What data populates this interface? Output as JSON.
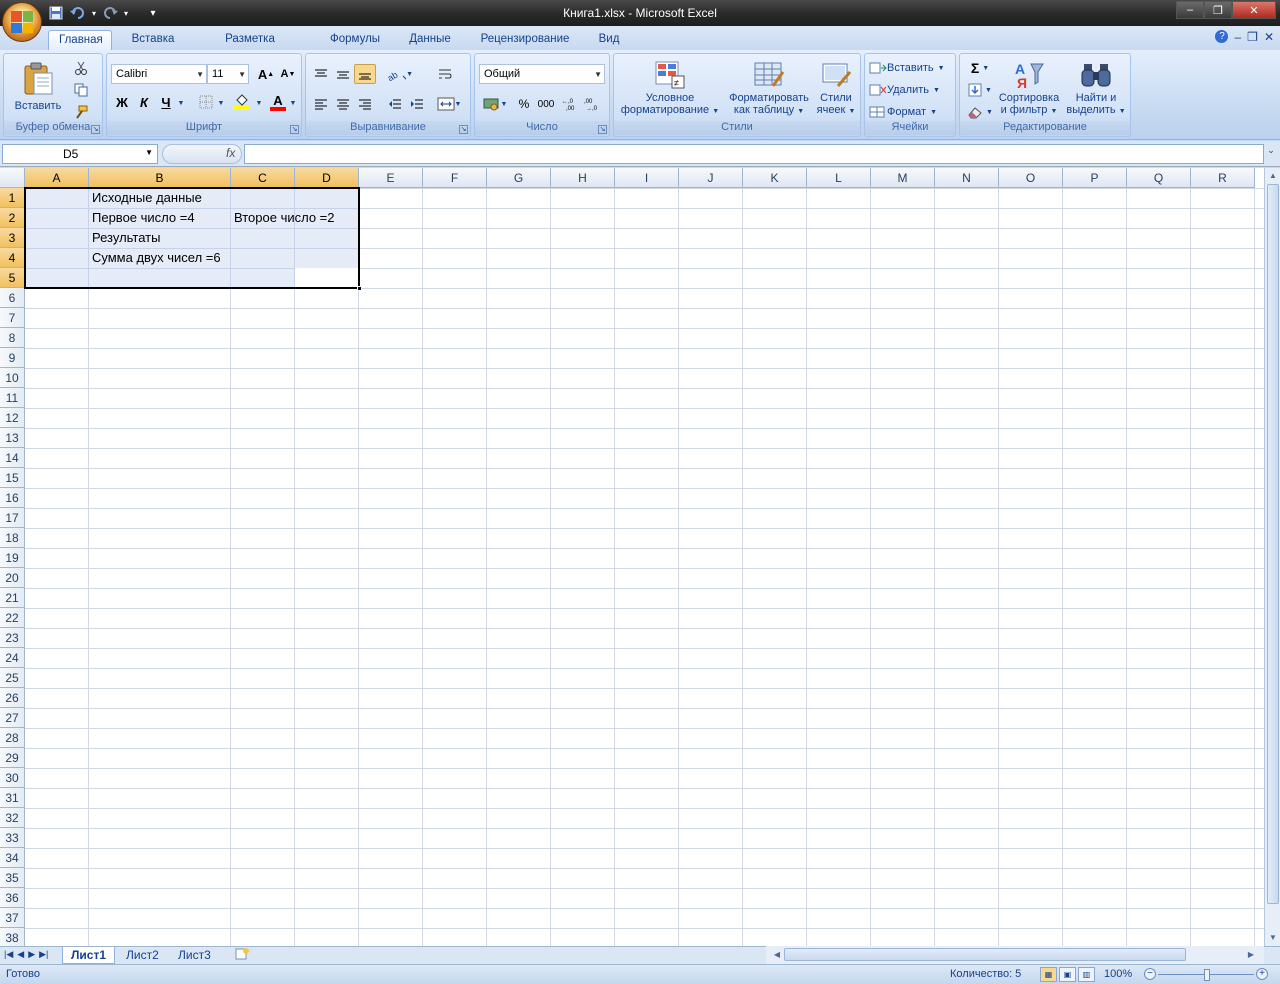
{
  "window": {
    "title": "Книга1.xlsx - Microsoft Excel",
    "minimize": "–",
    "restore": "❐",
    "close": "✕"
  },
  "qat": {
    "save_icon": "save-icon",
    "undo_icon": "undo-icon",
    "redo_icon": "redo-icon",
    "customize": "▾"
  },
  "tabs": [
    {
      "label": "Главная",
      "active": true
    },
    {
      "label": "Вставка"
    },
    {
      "label": "Разметка страницы"
    },
    {
      "label": "Формулы"
    },
    {
      "label": "Данные"
    },
    {
      "label": "Рецензирование"
    },
    {
      "label": "Вид"
    }
  ],
  "ribbon": {
    "clipboard": {
      "label": "Буфер обмена",
      "paste": "Вставить"
    },
    "font": {
      "label": "Шрифт",
      "name": "Calibri",
      "size": "11",
      "bold": "Ж",
      "italic": "К",
      "underline": "Ч",
      "grow": "A",
      "shrink": "A",
      "fill_color": "#ffff00",
      "font_color": "#ff0000",
      "color_letter": "A"
    },
    "alignment": {
      "label": "Выравнивание"
    },
    "number": {
      "label": "Число",
      "format": "Общий",
      "percent": "%",
      "thousands": "000"
    },
    "styles": {
      "label": "Стили",
      "cond_format_1": "Условное",
      "cond_format_2": "форматирование",
      "format_table_1": "Форматировать",
      "format_table_2": "как таблицу",
      "cell_styles_1": "Стили",
      "cell_styles_2": "ячеек"
    },
    "cells": {
      "label": "Ячейки",
      "insert": "Вставить",
      "delete": "Удалить",
      "format": "Формат"
    },
    "editing": {
      "label": "Редактирование",
      "sum": "Σ",
      "sort_1": "Сортировка",
      "sort_2": "и фильтр",
      "find_1": "Найти и",
      "find_2": "выделить"
    }
  },
  "formula_bar": {
    "name_box": "D5",
    "fx": "fx",
    "formula": ""
  },
  "columns": [
    "A",
    "B",
    "C",
    "D",
    "E",
    "F",
    "G",
    "H",
    "I",
    "J",
    "K",
    "L",
    "M",
    "N",
    "O",
    "P",
    "Q",
    "R"
  ],
  "rows": [
    "1",
    "2",
    "3",
    "4",
    "5",
    "6",
    "7",
    "8",
    "9",
    "10",
    "11",
    "12",
    "13",
    "14",
    "15",
    "16",
    "17",
    "18",
    "19",
    "20",
    "21",
    "22",
    "23",
    "24",
    "25",
    "26",
    "27",
    "28",
    "29",
    "30",
    "31",
    "32",
    "33",
    "34",
    "35",
    "36",
    "37",
    "38"
  ],
  "cells": {
    "B1": "Исходные данные",
    "B2": "Первое число =4",
    "C2": "Второе число =2",
    "B3": "Результаты",
    "B4": "Сумма двух чисел =6"
  },
  "sheets": [
    {
      "label": "Лист1",
      "active": true
    },
    {
      "label": "Лист2"
    },
    {
      "label": "Лист3"
    }
  ],
  "status": {
    "ready": "Готово",
    "count": "Количество: 5",
    "zoom": "100%",
    "zoom_minus": "−",
    "zoom_plus": "+"
  }
}
